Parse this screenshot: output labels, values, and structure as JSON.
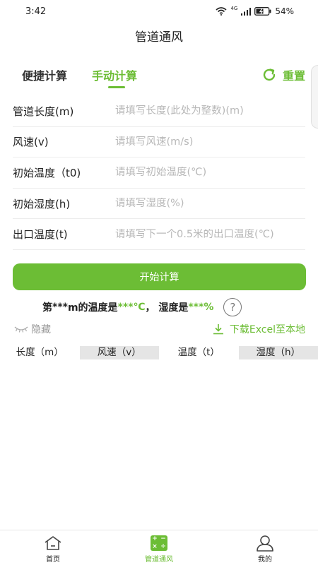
{
  "status": {
    "time": "3:42",
    "network": "4G",
    "battery": "54%"
  },
  "page_title": "管道通风",
  "tabs": [
    {
      "label": "便捷计算",
      "active": false
    },
    {
      "label": "手动计算",
      "active": true
    }
  ],
  "reset_label": "重置",
  "form": [
    {
      "label": "管道长度(m)",
      "value": "",
      "placeholder": "请填写长度(此处为整数)(m)"
    },
    {
      "label": "风速(v)",
      "value": "",
      "placeholder": "请填写风速(m/s)"
    },
    {
      "label": "初始温度（t0)",
      "value": "",
      "placeholder": "请填写初始温度(℃)"
    },
    {
      "label": "初始湿度(h)",
      "value": "",
      "placeholder": "请填写湿度(%)"
    },
    {
      "label": "出口温度(t)",
      "value": "",
      "placeholder": "请填写下一个0.5米的出口温度(℃)"
    }
  ],
  "calculate_label": "开始计算",
  "result": {
    "prefix": "第",
    "meter": "***",
    "mid1": "m的温度是",
    "temp": "***℃",
    "mid2": "，  湿度是",
    "humidity": "***%",
    "help": "?"
  },
  "hide_label": "隐藏",
  "download_label": "下载Excel至本地",
  "table_headers": [
    "长度（m）",
    "风速（v）",
    "温度（t）",
    "湿度（h）"
  ],
  "nav": [
    {
      "label": "首页",
      "icon": "home-icon",
      "active": false
    },
    {
      "label": "管道通风",
      "icon": "calculator-icon",
      "active": true
    },
    {
      "label": "我的",
      "icon": "user-icon",
      "active": false
    }
  ],
  "colors": {
    "accent": "#6cbd35",
    "text": "#222222",
    "placeholder": "#b8b8b8",
    "header_alt": "#e5e5e5"
  }
}
